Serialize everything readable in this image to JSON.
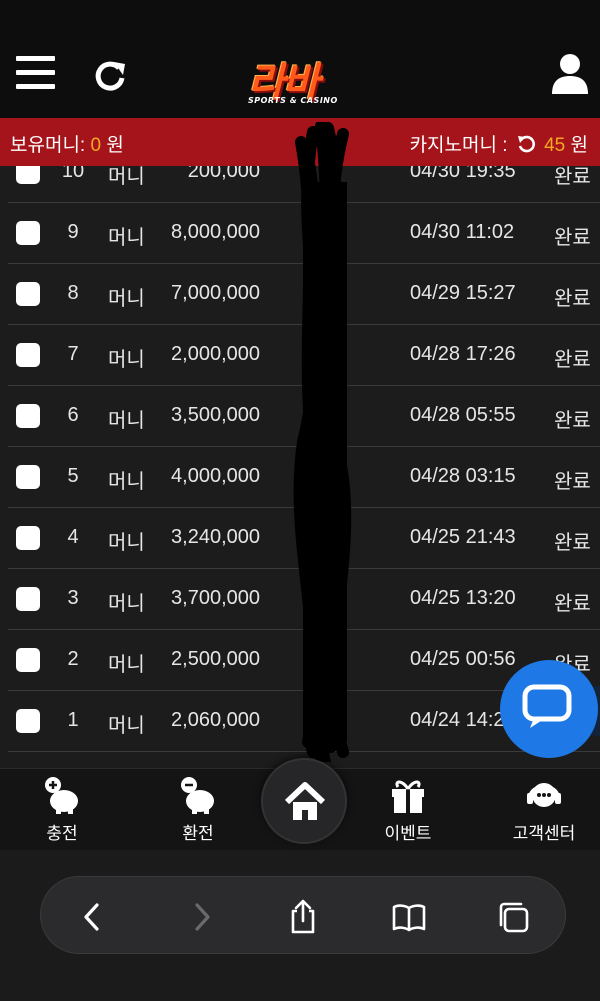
{
  "header": {
    "logo_main": "라바",
    "logo_sub": "SPORTS & CASINO"
  },
  "balance": {
    "label": "보유머니:",
    "value": "0",
    "unit": "원",
    "casino_label": "카지노머니 :",
    "casino_value": "45",
    "casino_unit": "원",
    "accent_color": "#f5a623",
    "bar_color": "#a5141a"
  },
  "rows": [
    {
      "num": "10",
      "type": "머니",
      "amount": "200,000",
      "date": "04/30 19:35",
      "status": "완료"
    },
    {
      "num": "9",
      "type": "머니",
      "amount": "8,000,000",
      "date": "04/30 11:02",
      "status": "완료"
    },
    {
      "num": "8",
      "type": "머니",
      "amount": "7,000,000",
      "date": "04/29 15:27",
      "status": "완료"
    },
    {
      "num": "7",
      "type": "머니",
      "amount": "2,000,000",
      "date": "04/28 17:26",
      "status": "완료"
    },
    {
      "num": "6",
      "type": "머니",
      "amount": "3,500,000",
      "date": "04/28 05:55",
      "status": "완료"
    },
    {
      "num": "5",
      "type": "머니",
      "amount": "4,000,000",
      "date": "04/28 03:15",
      "status": "완료"
    },
    {
      "num": "4",
      "type": "머니",
      "amount": "3,240,000",
      "date": "04/25 21:43",
      "status": "완료"
    },
    {
      "num": "3",
      "type": "머니",
      "amount": "3,700,000",
      "date": "04/25 13:20",
      "status": "완료"
    },
    {
      "num": "2",
      "type": "머니",
      "amount": "2,500,000",
      "date": "04/25 00:56",
      "status": "완료"
    },
    {
      "num": "1",
      "type": "머니",
      "amount": "2,060,000",
      "date": "04/24 14:2",
      "status": ""
    }
  ],
  "bottom_nav": {
    "deposit": "충전",
    "withdraw": "환전",
    "events": "이벤트",
    "support": "고객센터"
  },
  "icons": {
    "menu": "hamburger-menu-icon",
    "refresh": "refresh-icon",
    "user": "user-icon",
    "home": "home-icon",
    "chat": "chat-bubble-icon",
    "gift": "gift-icon",
    "headset": "headset-icon"
  }
}
